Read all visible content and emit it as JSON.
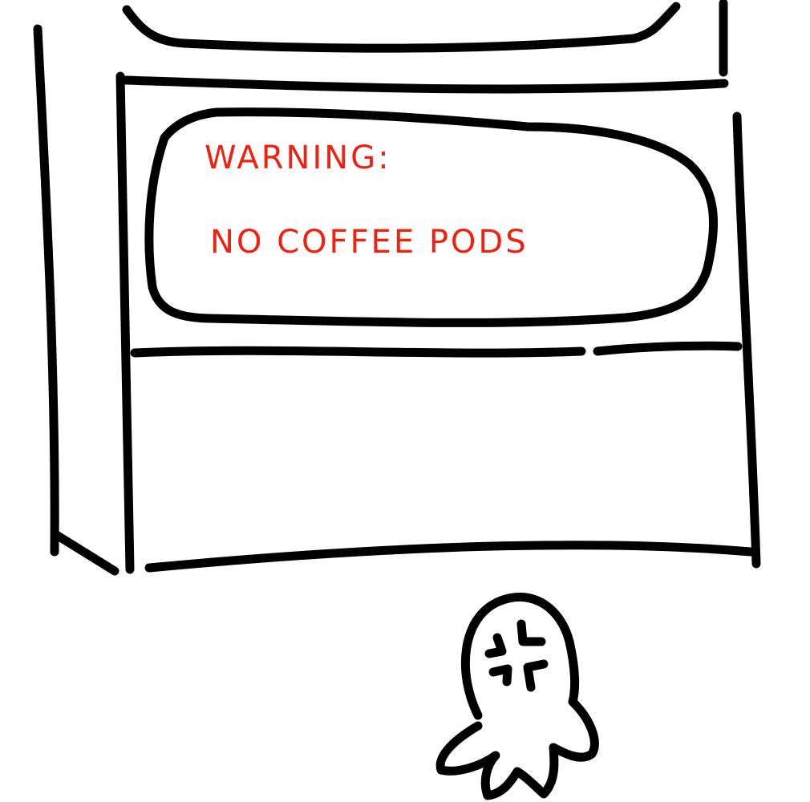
{
  "warning": {
    "title": "WARNING:",
    "message": "NO COFFEE PODS"
  },
  "icons": {
    "angry_mark": "anger-vein-icon"
  },
  "colors": {
    "ink": "#000000",
    "warning_text": "#ee2211",
    "background": "#ffffff"
  }
}
